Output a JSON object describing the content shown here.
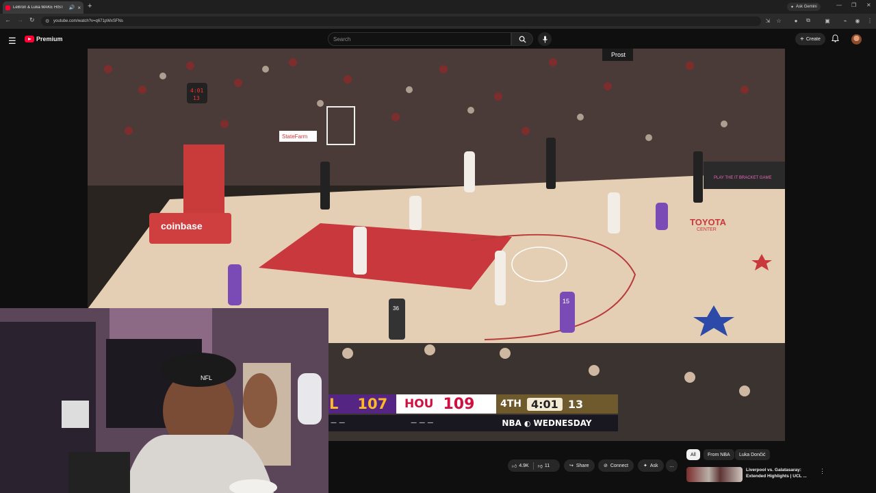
{
  "browser": {
    "tab_title": "LeBron & Luka MAKE HIST",
    "new_tab": "+",
    "url": "youtube.com/watch?v=q671pWxSFNs",
    "ask_gemini": "Ask Gemini"
  },
  "header": {
    "logo_text": "Premium",
    "search_placeholder": "Search",
    "create_label": "Create"
  },
  "video": {
    "scoreboard": {
      "away_abbr": "L",
      "away_score": "107",
      "home_abbr": "HOU",
      "home_score": "109",
      "quarter": "4TH",
      "clock": "4:01",
      "shot_clock": "13",
      "away_dashes": "— —",
      "home_dashes": "— — —",
      "broadcast": "NBA",
      "day": "WEDNESDAY"
    },
    "court_signs": {
      "coinbase": "coinbase",
      "toyota": "TOYOTA",
      "center": "CENTER",
      "statefarm": "StateFarm",
      "prost": "Prost",
      "play_bracket": "PLAY THE IT BRACKET GAME",
      "shot_clock_display": "4:01",
      "shot_clock_num": "13"
    },
    "jerseys": {
      "p1": "15",
      "ref": "36"
    },
    "cam_cap_logo": "NFL"
  },
  "actions": {
    "like_count": "4.9K",
    "dislike_count": "11",
    "share": "Share",
    "connect": "Connect",
    "ask": "Ask",
    "more": "…"
  },
  "chips": [
    "All",
    "From NBA",
    "Luka Dončić"
  ],
  "recommendation": {
    "title_line1": "Liverpool vs. Galatasaray:",
    "title_line2": "Extended Highlights | UCL ..."
  }
}
